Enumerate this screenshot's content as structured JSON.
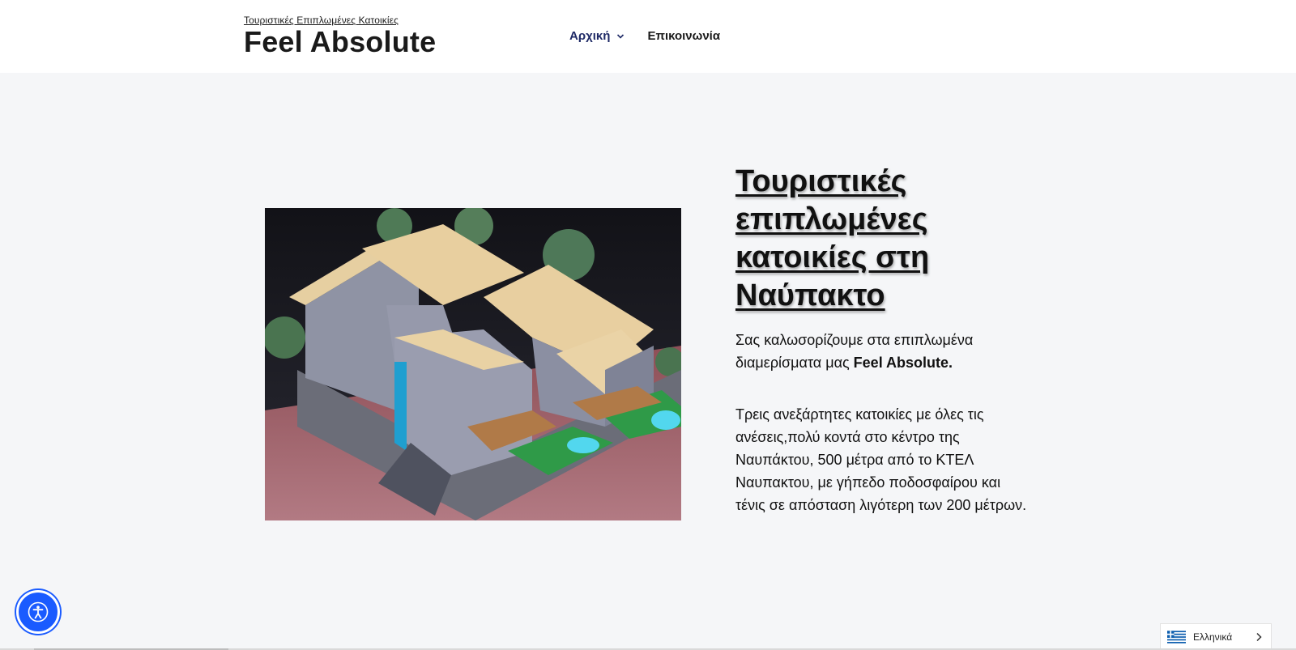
{
  "header": {
    "tagline": "Τουριστικές Επιπλωμένες Κατοικίες",
    "brand": "Feel Absolute"
  },
  "nav": {
    "items": [
      {
        "label": "Αρχική",
        "active": true,
        "has_dropdown": true
      },
      {
        "label": "Επικοινωνία",
        "active": false,
        "has_dropdown": false
      }
    ]
  },
  "hero": {
    "image_alt": "architectural render of the residences",
    "heading": "Τουριστικές επιπλωμένες κατοικίες στη Ναύπακτο",
    "intro_text": "Σας καλωσορίζουμε στα επιπλωμένα διαμερίσματα μας ",
    "intro_bold": "Feel Absolute.",
    "description": "Τρεις ανεξάρτητες κατοικίες με όλες τις ανέσεις,πολύ κοντά στο κέντρο της Ναυπάκτου, 500 μέτρα από το ΚΤΕΛ Ναυπακτου, με γήπεδο ποδοσφαίρου και τένις σε απόσταση λιγότερη των 200 μέτρων."
  },
  "accessibility": {
    "icon": "accessibility-icon"
  },
  "language": {
    "current": "Ελληνικά",
    "flag": "greek-flag-icon"
  },
  "colors": {
    "nav_active": "#1f2a66",
    "a11y_button": "#1a5bff",
    "page_bg": "#f5f6f8"
  }
}
